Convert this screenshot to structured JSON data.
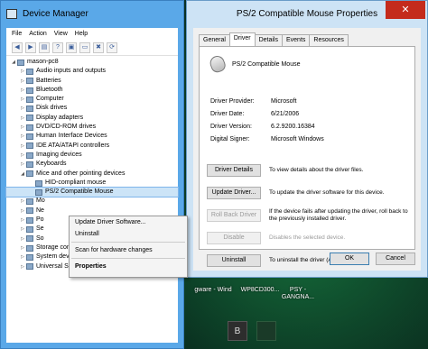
{
  "device_manager": {
    "title": "Device Manager",
    "menu": [
      "File",
      "Action",
      "View",
      "Help"
    ],
    "toolbar": [
      "back-arrow",
      "forward-arrow",
      "properties",
      "help",
      "update-driver",
      "monitor",
      "uninstall",
      "scan"
    ],
    "tree": [
      {
        "label": "mason-pc8",
        "level": 0,
        "expander": "open"
      },
      {
        "label": "Audio inputs and outputs",
        "level": 1,
        "expander": "closed"
      },
      {
        "label": "Batteries",
        "level": 1,
        "expander": "closed"
      },
      {
        "label": "Bluetooth",
        "level": 1,
        "expander": "closed"
      },
      {
        "label": "Computer",
        "level": 1,
        "expander": "closed"
      },
      {
        "label": "Disk drives",
        "level": 1,
        "expander": "closed"
      },
      {
        "label": "Display adapters",
        "level": 1,
        "expander": "closed"
      },
      {
        "label": "DVD/CD-ROM drives",
        "level": 1,
        "expander": "closed"
      },
      {
        "label": "Human Interface Devices",
        "level": 1,
        "expander": "closed"
      },
      {
        "label": "IDE ATA/ATAPI controllers",
        "level": 1,
        "expander": "closed"
      },
      {
        "label": "Imaging devices",
        "level": 1,
        "expander": "closed"
      },
      {
        "label": "Keyboards",
        "level": 1,
        "expander": "closed"
      },
      {
        "label": "Mice and other pointing devices",
        "level": 1,
        "expander": "open"
      },
      {
        "label": "HID-compliant mouse",
        "level": 2,
        "expander": ""
      },
      {
        "label": "PS/2 Compatible Mouse",
        "level": 2,
        "expander": "",
        "selected": true
      },
      {
        "label": "Mo",
        "level": 1,
        "expander": "closed"
      },
      {
        "label": "Ne",
        "level": 1,
        "expander": "closed"
      },
      {
        "label": "Po",
        "level": 1,
        "expander": "closed"
      },
      {
        "label": "Se",
        "level": 1,
        "expander": "closed"
      },
      {
        "label": "So",
        "level": 1,
        "expander": "closed"
      },
      {
        "label": "Storage controllers",
        "level": 1,
        "expander": "closed"
      },
      {
        "label": "System devices",
        "level": 1,
        "expander": "closed"
      },
      {
        "label": "Universal Serial Bus controllers",
        "level": 1,
        "expander": "closed"
      }
    ]
  },
  "context_menu": {
    "items": [
      "Update Driver Software...",
      "Uninstall",
      "Scan for hardware changes",
      "Properties"
    ]
  },
  "properties": {
    "title": "PS/2 Compatible Mouse Properties",
    "close_glyph": "✕",
    "tabs": [
      "General",
      "Driver",
      "Details",
      "Events",
      "Resources"
    ],
    "active_tab": "Driver",
    "device_name": "PS/2 Compatible Mouse",
    "info": [
      {
        "key": "Driver Provider:",
        "value": "Microsoft"
      },
      {
        "key": "Driver Date:",
        "value": "6/21/2006"
      },
      {
        "key": "Driver Version:",
        "value": "6.2.9200.16384"
      },
      {
        "key": "Digital Signer:",
        "value": "Microsoft Windows"
      }
    ],
    "actions": [
      {
        "button": "Driver Details",
        "desc": "To view details about the driver files.",
        "enabled": true
      },
      {
        "button": "Update Driver...",
        "desc": "To update the driver software for this device.",
        "enabled": true
      },
      {
        "button": "Roll Back Driver",
        "desc": "If the device fails after updating the driver, roll back to the previously installed driver.",
        "enabled": false
      },
      {
        "button": "Disable",
        "desc": "Disables the selected device.",
        "enabled": false
      },
      {
        "button": "Uninstall",
        "desc": "To uninstall the driver (Advanced).",
        "enabled": true
      }
    ],
    "ok": "OK",
    "cancel": "Cancel"
  },
  "desktop": {
    "icons": [
      "gware - Wind",
      "WP8CD300...",
      "PSY - GANGNA..."
    ],
    "taskbar_tile": "B"
  }
}
